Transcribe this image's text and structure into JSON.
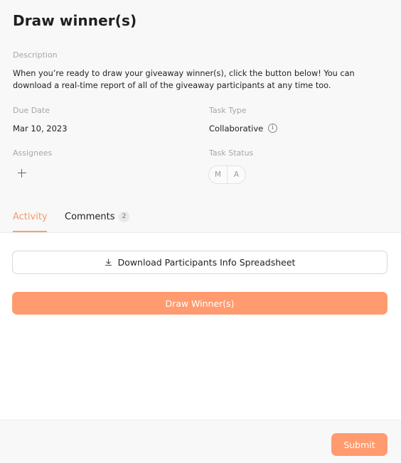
{
  "title": "Draw winner(s)",
  "description": {
    "label": "Description",
    "text": "When you’re ready to draw your giveaway winner(s), click the button below! You can download a real-time report of all of the giveaway participants at any time too."
  },
  "due_date": {
    "label": "Due Date",
    "value": "Mar 10, 2023"
  },
  "task_type": {
    "label": "Task Type",
    "value": "Collaborative",
    "icon": "info-icon"
  },
  "assignees": {
    "label": "Assignees",
    "icon": "plus-icon"
  },
  "task_status": {
    "label": "Task Status",
    "options": [
      "M",
      "A"
    ]
  },
  "tabs": [
    {
      "label": "Activity",
      "active": true
    },
    {
      "label": "Comments",
      "count": "2"
    }
  ],
  "actions": {
    "download_label": "Download Participants Info Spreadsheet",
    "download_icon": "download-icon",
    "draw_label": "Draw Winner(s)"
  },
  "footer": {
    "submit_label": "Submit"
  },
  "colors": {
    "accent": "#ff9b6e",
    "active_tab": "#f29a6a",
    "panel_bg": "#f8f8f8"
  }
}
